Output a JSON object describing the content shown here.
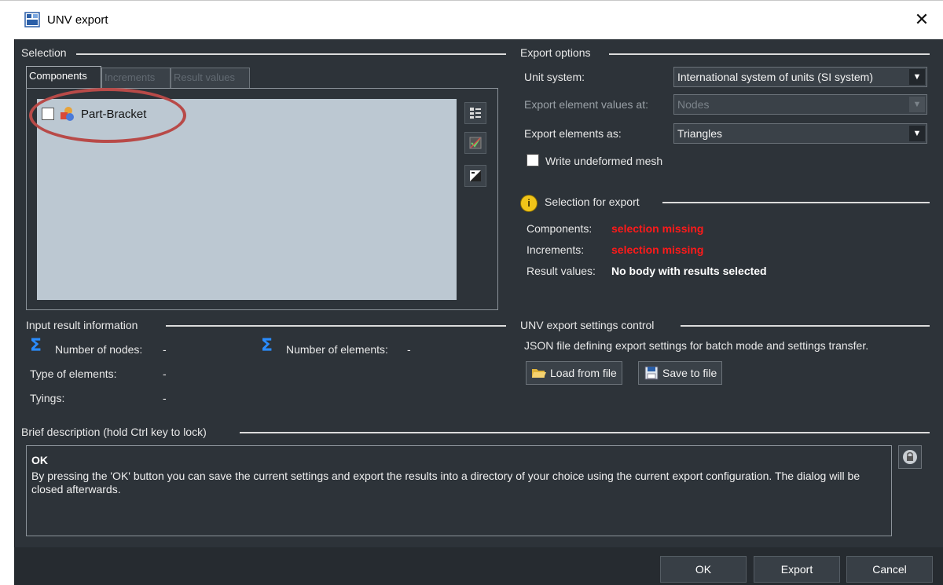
{
  "window": {
    "title": "UNV export"
  },
  "selection": {
    "title": "Selection",
    "tabs": [
      {
        "label": "Components"
      },
      {
        "label": "Increments"
      },
      {
        "label": "Result values"
      }
    ],
    "items": [
      {
        "label": "Part-Bracket",
        "checked": false
      }
    ]
  },
  "export_options": {
    "title": "Export options",
    "unit_system": {
      "label": "Unit system:",
      "value": "International system of units (SI system)"
    },
    "element_values_at": {
      "label": "Export element values at:",
      "value": "Nodes"
    },
    "elements_as": {
      "label": "Export elements as:",
      "value": "Triangles"
    },
    "write_undeformed": {
      "label": "Write undeformed mesh",
      "checked": false
    }
  },
  "selection_for_export": {
    "title": "Selection for export",
    "components_label": "Components:",
    "components_value": "selection missing",
    "increments_label": "Increments:",
    "increments_value": "selection missing",
    "result_values_label": "Result values:",
    "result_values_value": "No body with results selected"
  },
  "input_result": {
    "title": "Input result information",
    "nodes_label": "Number of nodes:",
    "nodes_value": "-",
    "elements_label": "Number of elements:",
    "elements_value": "-",
    "type_label": "Type of elements:",
    "type_value": "-",
    "tyings_label": "Tyings:",
    "tyings_value": "-"
  },
  "settings_control": {
    "title": "UNV export settings control",
    "description": "JSON file defining export settings for batch mode and settings transfer.",
    "load_label": "Load from file",
    "save_label": "Save to file"
  },
  "brief": {
    "title": "Brief description (hold Ctrl key to lock)",
    "heading": "OK",
    "text": "By pressing the 'OK' button you can save the current settings and export the results into a directory of your choice using the current export configuration. The dialog will be closed afterwards."
  },
  "footer": {
    "ok_label": "OK",
    "export_label": "Export",
    "cancel_label": "Cancel"
  },
  "colors": {
    "background": "#2d3339",
    "error": "#ff1a1a",
    "highlight": "#b84a48",
    "sigma": "#2a8cff"
  }
}
